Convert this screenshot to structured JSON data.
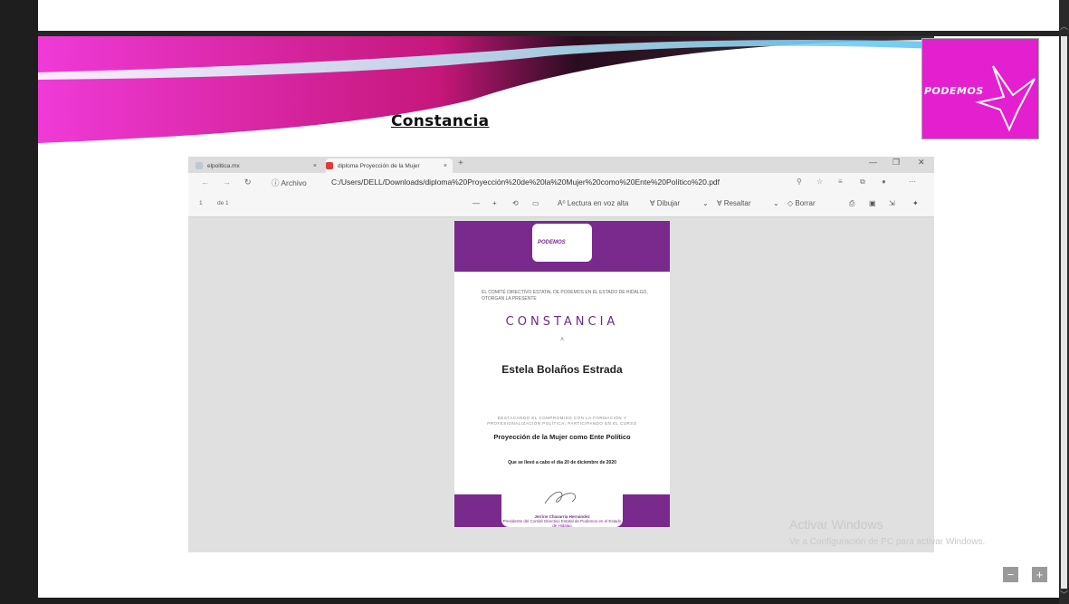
{
  "slide": {
    "title": "Constancia",
    "logo_text": "PODEMOS"
  },
  "browser": {
    "tabs": [
      {
        "label": "elpolitica.mx",
        "close": "×"
      },
      {
        "label": "diploma Proyección de la Mujer",
        "close": "×"
      }
    ],
    "new_tab": "+",
    "window_controls": {
      "minimize": "—",
      "maximize": "❐",
      "close": "✕"
    },
    "address": {
      "scheme_label": "ⓘ Archivo",
      "url": "C:/Users/DELL/Downloads/diploma%20Proyección%20de%20la%20Mujer%20como%20Ente%20Político%20.pdf"
    },
    "pdf_toolbar": {
      "page_input": "1",
      "page_of": "de 1",
      "zoom_out": "—",
      "zoom_in": "+",
      "read_aloud": "A⁰ Lectura en voz alta",
      "draw": "∀ Dibujar",
      "highlight": "∀ Resaltar",
      "erase": "◇ Borrar"
    }
  },
  "pdf": {
    "logo_text": "PODEMOS",
    "intro": "EL COMITÉ DIRECTIVO ESTATAL DE PODEMOS EN EL ESTADO DE HIDALGO, OTORGAN LA PRESENTE",
    "heading": "CONSTANCIA",
    "a": "A",
    "recipient": "Estela Bolaños Estrada",
    "reason": "DESTACANDO EL COMPROMISO CON LA FORMACIÓN Y PROFESIONALIZACIÓN POLÍTICA, PARTICIPANDO EN EL CURSO",
    "course": "Proyección de la Mujer como Ente Político",
    "date": "Que se llevó a cabo el día 20 de diciembre de 2020",
    "signer": "Jerrine Chavarria Hernández",
    "signer_role": "Presidente del Comité Directivo Estatal de Podemos en el Estado de Hidalgo"
  },
  "watermark": {
    "line1": "Activar Windows",
    "line2": "Ve a Configuración de PC para activar Windows."
  },
  "controls": {
    "minus": "−",
    "plus": "+"
  }
}
